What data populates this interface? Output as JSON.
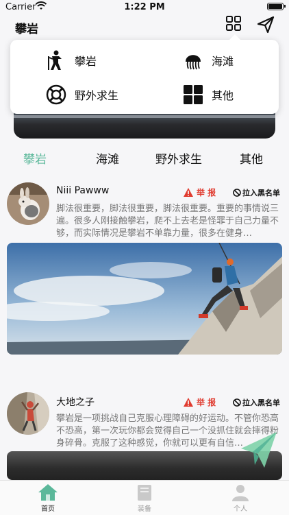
{
  "status_bar": {
    "carrier": "Carrier",
    "time": "1:22 PM"
  },
  "nav": {
    "title": "攀岩"
  },
  "dropdown": {
    "items": [
      {
        "label": "攀岩",
        "icon": "climber-icon"
      },
      {
        "label": "海滩",
        "icon": "jellyfish-icon"
      },
      {
        "label": "野外求生",
        "icon": "lifebuoy-icon"
      },
      {
        "label": "其他",
        "icon": "grid-icon"
      }
    ]
  },
  "categories": [
    "攀岩",
    "海滩",
    "野外求生",
    "其他"
  ],
  "posts": [
    {
      "username": "Niii Pawww",
      "report_label": "举 报",
      "block_label": "拉入黑名单",
      "text": "脚法很重要，脚法很重要，脚法很重要。重要的事情说三遍。很多人刚接触攀岩，爬不上去老是怪罪于自己力量不够，而实际情况是攀岩不单靠力量，很多在健身…"
    },
    {
      "username": "大地之子",
      "report_label": "举 报",
      "block_label": "拉入黑名单",
      "text": "攀岩是一项挑战自己克服心理障碍的好运动。不管你恐高不恐高，第一次玩你都会觉得自己一个没抓住就会摔得粉身碎骨。克服了这种感觉，你就可以更有自信…"
    }
  ],
  "tabbar": {
    "items": [
      "首页",
      "装备",
      "个人"
    ]
  },
  "colors": {
    "accent": "#5bb89a",
    "report": "#e03b2f",
    "fab": "#7ed3a8"
  }
}
